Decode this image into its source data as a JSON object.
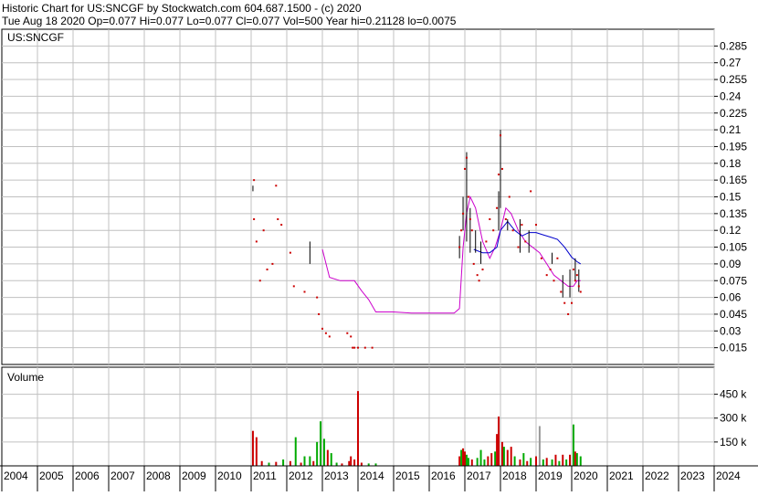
{
  "header": {
    "line1": "Historic Chart for US:SNCGF by Stockwatch.com 604.687.1500 - (c) 2020",
    "line2": "Tue Aug 18 2020  Op=0.077  Hi=0.077  Lo=0.077  Cl=0.077  Vol=500  Year hi=0.21128  lo=0.0075"
  },
  "chart_data": [
    {
      "type": "line",
      "title": "US:SNCGF",
      "ylim": [
        0,
        0.3
      ],
      "y_ticks": [
        "0.285",
        "0.27",
        "0.255",
        "0.24",
        "0.225",
        "0.21",
        "0.195",
        "0.18",
        "0.165",
        "0.15",
        "0.135",
        "0.12",
        "0.105",
        "0.09",
        "0.075",
        "0.06",
        "0.045",
        "0.03",
        "0.015"
      ],
      "x_ticks": [
        "2004",
        "2005",
        "2006",
        "2007",
        "2008",
        "2009",
        "2010",
        "2011",
        "2012",
        "2013",
        "2014",
        "2015",
        "2016",
        "2017",
        "2018",
        "2019",
        "2020",
        "2021",
        "2022",
        "2023",
        "2024"
      ],
      "grid": true,
      "colors": {
        "price": "#cc0000",
        "hilo": "#000000",
        "ma_short": "#0000cc",
        "ma_long": "#cc00cc",
        "grid": "#c0c0c0"
      },
      "series": [
        {
          "kind": "price_points",
          "x": [
            2011.08,
            2011.08,
            2011.15,
            2011.25,
            2011.35,
            2011.45,
            2011.6,
            2011.7,
            2011.75,
            2011.85,
            2012.1,
            2012.2,
            2012.5,
            2012.85,
            2012.9,
            2013.0,
            2013.1,
            2013.2,
            2013.7,
            2013.8,
            2013.85,
            2013.9,
            2014.0,
            2014.2,
            2014.4,
            2016.85,
            2016.9,
            2016.95,
            2017.0,
            2017.05,
            2017.1,
            2017.15,
            2017.2,
            2017.25,
            2017.35,
            2017.4,
            2017.5,
            2017.6,
            2017.7,
            2017.8,
            2017.9,
            2017.95,
            2018.0,
            2018.05,
            2018.15,
            2018.25,
            2018.35,
            2018.5,
            2018.6,
            2018.7,
            2018.85,
            2019.0,
            2019.15,
            2019.3,
            2019.4,
            2019.5,
            2019.6,
            2019.7,
            2019.8,
            2019.9,
            2020.0,
            2020.05,
            2020.1,
            2020.15,
            2020.2,
            2020.25
          ],
          "y": [
            0.165,
            0.13,
            0.11,
            0.075,
            0.12,
            0.085,
            0.09,
            0.16,
            0.13,
            0.125,
            0.1,
            0.07,
            0.065,
            0.06,
            0.045,
            0.032,
            0.028,
            0.025,
            0.028,
            0.025,
            0.015,
            0.015,
            0.015,
            0.015,
            0.015,
            0.105,
            0.12,
            0.135,
            0.175,
            0.185,
            0.15,
            0.13,
            0.12,
            0.09,
            0.08,
            0.075,
            0.085,
            0.11,
            0.13,
            0.12,
            0.14,
            0.17,
            0.205,
            0.175,
            0.13,
            0.15,
            0.12,
            0.105,
            0.125,
            0.11,
            0.155,
            0.125,
            0.095,
            0.08,
            0.085,
            0.075,
            0.095,
            0.065,
            0.055,
            0.045,
            0.055,
            0.085,
            0.075,
            0.08,
            0.07,
            0.065
          ]
        },
        {
          "kind": "high_low_bars",
          "x": [
            2011.05,
            2012.65,
            2016.85,
            2016.95,
            2017.05,
            2017.15,
            2017.3,
            2017.45,
            2017.95,
            2018.0,
            2018.2,
            2018.55,
            2018.8,
            2019.45,
            2019.75,
            2019.95,
            2020.1,
            2020.2
          ],
          "high": [
            0.16,
            0.11,
            0.115,
            0.15,
            0.19,
            0.14,
            0.12,
            0.11,
            0.155,
            0.21,
            0.13,
            0.13,
            0.12,
            0.1,
            0.08,
            0.085,
            0.095,
            0.085
          ],
          "low": [
            0.155,
            0.09,
            0.095,
            0.12,
            0.11,
            0.1,
            0.1,
            0.09,
            0.12,
            0.14,
            0.12,
            0.1,
            0.1,
            0.09,
            0.06,
            0.06,
            0.075,
            0.065
          ]
        },
        {
          "kind": "ma_long",
          "x": [
            2013.0,
            2013.2,
            2013.5,
            2013.9,
            2014.1,
            2014.3,
            2014.5,
            2015.0,
            2015.5,
            2016.0,
            2016.7,
            2016.85,
            2016.95,
            2017.05,
            2017.15,
            2017.3,
            2017.5,
            2017.7,
            2017.85,
            2018.0,
            2018.15,
            2018.3,
            2018.5,
            2018.7,
            2018.9,
            2019.1,
            2019.3,
            2019.5,
            2019.7,
            2019.9,
            2020.05,
            2020.15,
            2020.25
          ],
          "y": [
            0.103,
            0.078,
            0.075,
            0.075,
            0.066,
            0.058,
            0.047,
            0.047,
            0.046,
            0.046,
            0.046,
            0.05,
            0.105,
            0.135,
            0.15,
            0.14,
            0.11,
            0.095,
            0.105,
            0.12,
            0.14,
            0.135,
            0.12,
            0.11,
            0.105,
            0.1,
            0.09,
            0.08,
            0.075,
            0.07,
            0.07,
            0.075,
            0.075
          ]
        },
        {
          "kind": "ma_short",
          "x": [
            2017.25,
            2017.5,
            2017.7,
            2017.9,
            2018.0,
            2018.2,
            2018.4,
            2018.6,
            2018.8,
            2019.0,
            2019.2,
            2019.4,
            2019.6,
            2019.8,
            2020.0,
            2020.15,
            2020.25
          ],
          "y": [
            0.103,
            0.1,
            0.1,
            0.105,
            0.12,
            0.128,
            0.12,
            0.115,
            0.118,
            0.118,
            0.116,
            0.114,
            0.112,
            0.105,
            0.096,
            0.092,
            0.09
          ]
        }
      ]
    },
    {
      "type": "bar",
      "title": "Volume",
      "ylim": [
        0,
        620000
      ],
      "y_ticks": [
        "450 k",
        "300 k",
        "150 k"
      ],
      "y_tick_values": [
        450000,
        300000,
        150000
      ],
      "colors": {
        "up": "#00aa00",
        "down": "#cc0000",
        "flat": "#999999"
      },
      "bars": [
        {
          "x": 2011.05,
          "v": 220000,
          "c": "down"
        },
        {
          "x": 2011.15,
          "v": 180000,
          "c": "down"
        },
        {
          "x": 2011.3,
          "v": 30000,
          "c": "down"
        },
        {
          "x": 2011.5,
          "v": 20000,
          "c": "up"
        },
        {
          "x": 2011.7,
          "v": 25000,
          "c": "down"
        },
        {
          "x": 2011.9,
          "v": 40000,
          "c": "up"
        },
        {
          "x": 2012.1,
          "v": 30000,
          "c": "down"
        },
        {
          "x": 2012.25,
          "v": 180000,
          "c": "up"
        },
        {
          "x": 2012.4,
          "v": 20000,
          "c": "down"
        },
        {
          "x": 2012.5,
          "v": 60000,
          "c": "up"
        },
        {
          "x": 2012.65,
          "v": 60000,
          "c": "up"
        },
        {
          "x": 2012.75,
          "v": 30000,
          "c": "down"
        },
        {
          "x": 2012.85,
          "v": 150000,
          "c": "up"
        },
        {
          "x": 2012.95,
          "v": 280000,
          "c": "up"
        },
        {
          "x": 2013.05,
          "v": 170000,
          "c": "up"
        },
        {
          "x": 2013.15,
          "v": 100000,
          "c": "down"
        },
        {
          "x": 2013.25,
          "v": 80000,
          "c": "up"
        },
        {
          "x": 2013.4,
          "v": 20000,
          "c": "up"
        },
        {
          "x": 2013.55,
          "v": 15000,
          "c": "down"
        },
        {
          "x": 2013.75,
          "v": 30000,
          "c": "down"
        },
        {
          "x": 2013.8,
          "v": 60000,
          "c": "down"
        },
        {
          "x": 2013.9,
          "v": 40000,
          "c": "down"
        },
        {
          "x": 2014.0,
          "v": 470000,
          "c": "down"
        },
        {
          "x": 2014.1,
          "v": 20000,
          "c": "down"
        },
        {
          "x": 2014.3,
          "v": 15000,
          "c": "up"
        },
        {
          "x": 2014.5,
          "v": 15000,
          "c": "up"
        },
        {
          "x": 2016.85,
          "v": 60000,
          "c": "down"
        },
        {
          "x": 2016.9,
          "v": 100000,
          "c": "up"
        },
        {
          "x": 2016.95,
          "v": 110000,
          "c": "down"
        },
        {
          "x": 2017.0,
          "v": 90000,
          "c": "down"
        },
        {
          "x": 2017.05,
          "v": 70000,
          "c": "up"
        },
        {
          "x": 2017.1,
          "v": 50000,
          "c": "up"
        },
        {
          "x": 2017.2,
          "v": 40000,
          "c": "down"
        },
        {
          "x": 2017.35,
          "v": 50000,
          "c": "up"
        },
        {
          "x": 2017.45,
          "v": 100000,
          "c": "up"
        },
        {
          "x": 2017.55,
          "v": 40000,
          "c": "up"
        },
        {
          "x": 2017.65,
          "v": 60000,
          "c": "down"
        },
        {
          "x": 2017.75,
          "v": 80000,
          "c": "down"
        },
        {
          "x": 2017.85,
          "v": 90000,
          "c": "up"
        },
        {
          "x": 2017.9,
          "v": 200000,
          "c": "down"
        },
        {
          "x": 2017.95,
          "v": 310000,
          "c": "down"
        },
        {
          "x": 2018.05,
          "v": 150000,
          "c": "down"
        },
        {
          "x": 2018.1,
          "v": 120000,
          "c": "up"
        },
        {
          "x": 2018.2,
          "v": 100000,
          "c": "down"
        },
        {
          "x": 2018.3,
          "v": 120000,
          "c": "down"
        },
        {
          "x": 2018.4,
          "v": 60000,
          "c": "up"
        },
        {
          "x": 2018.55,
          "v": 40000,
          "c": "down"
        },
        {
          "x": 2018.65,
          "v": 80000,
          "c": "up"
        },
        {
          "x": 2018.75,
          "v": 30000,
          "c": "down"
        },
        {
          "x": 2018.85,
          "v": 50000,
          "c": "up"
        },
        {
          "x": 2019.0,
          "v": 60000,
          "c": "down"
        },
        {
          "x": 2019.1,
          "v": 250000,
          "c": "flat"
        },
        {
          "x": 2019.2,
          "v": 40000,
          "c": "up"
        },
        {
          "x": 2019.3,
          "v": 50000,
          "c": "down"
        },
        {
          "x": 2019.45,
          "v": 40000,
          "c": "up"
        },
        {
          "x": 2019.55,
          "v": 70000,
          "c": "down"
        },
        {
          "x": 2019.65,
          "v": 30000,
          "c": "up"
        },
        {
          "x": 2019.75,
          "v": 70000,
          "c": "down"
        },
        {
          "x": 2019.85,
          "v": 40000,
          "c": "up"
        },
        {
          "x": 2019.95,
          "v": 70000,
          "c": "down"
        },
        {
          "x": 2020.05,
          "v": 260000,
          "c": "up"
        },
        {
          "x": 2020.1,
          "v": 90000,
          "c": "down"
        },
        {
          "x": 2020.15,
          "v": 80000,
          "c": "up"
        },
        {
          "x": 2020.25,
          "v": 60000,
          "c": "up"
        }
      ]
    }
  ]
}
